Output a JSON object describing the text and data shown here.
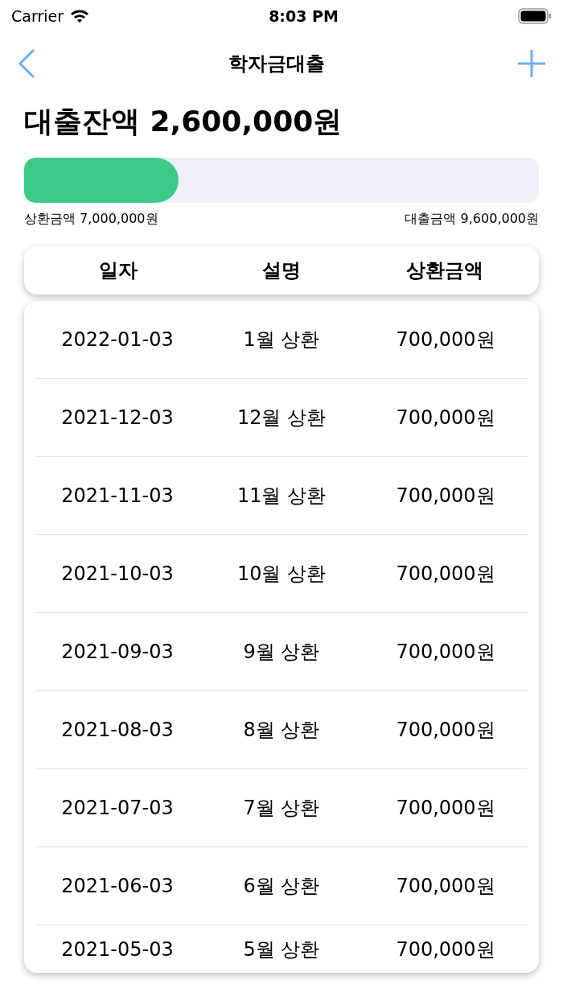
{
  "status_bar": {
    "carrier": "Carrier",
    "time": "8:03 PM"
  },
  "nav": {
    "title": "학자금대출"
  },
  "balance": {
    "text": "대출잔액 2,600,000원"
  },
  "progress": {
    "level": 0.3,
    "repaid_label": "상환금액 7,000,000원",
    "loan_label": "대출금액 9,600,000원"
  },
  "table": {
    "columns": [
      "일자",
      "설명",
      "상환금액"
    ],
    "rows": [
      [
        "2022-01-03",
        "1월 상환",
        "700,000원"
      ],
      [
        "2021-12-03",
        "12월 상환",
        "700,000원"
      ],
      [
        "2021-11-03",
        "11월 상환",
        "700,000원"
      ],
      [
        "2021-10-03",
        "10월 상환",
        "700,000원"
      ],
      [
        "2021-09-03",
        "9월 상환",
        "700,000원"
      ],
      [
        "2021-08-03",
        "8월 상환",
        "700,000원"
      ],
      [
        "2021-07-03",
        "7월 상환",
        "700,000원"
      ],
      [
        "2021-06-03",
        "6월 상환",
        "700,000원"
      ],
      [
        "2021-05-03",
        "5월 상환",
        "700,000원"
      ]
    ]
  }
}
